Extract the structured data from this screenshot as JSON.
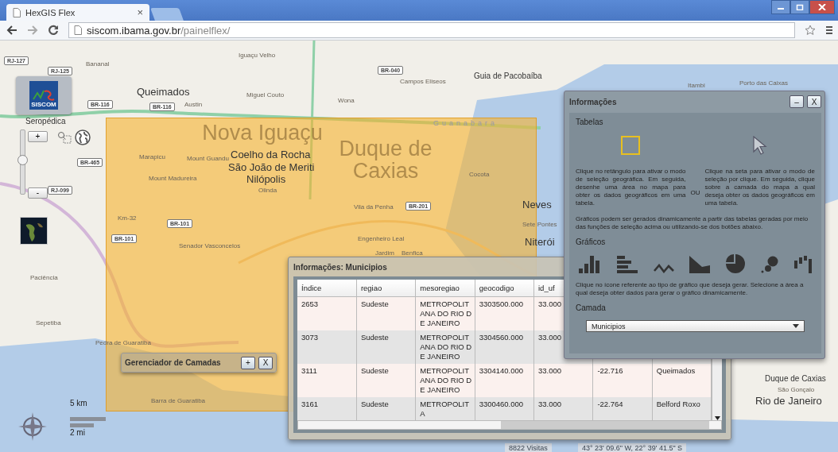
{
  "browser": {
    "tab_title": "HexGIS Flex",
    "tab_close": "×",
    "url_host": "siscom.ibama.gov.br",
    "url_path": "/painelflex/"
  },
  "map": {
    "logo_text": "SISCOM",
    "zoom_in": "+",
    "zoom_out": "-",
    "zoom_slider": {
      "level": 0.53
    },
    "labels": [
      {
        "text": "Queimados",
        "kind": "city"
      },
      {
        "text": "Nova Iguaçu",
        "kind": "big"
      },
      {
        "text": "Coelho da Rocha",
        "kind": "city"
      },
      {
        "text": "São João de Meriti",
        "kind": "city"
      },
      {
        "text": "Nilópolis",
        "kind": "city"
      },
      {
        "text": "Duque de Caxias",
        "kind": "big"
      },
      {
        "text": "Olinda",
        "kind": "small"
      },
      {
        "text": "Seropédica",
        "kind": "place"
      },
      {
        "text": "Bananal",
        "kind": "small"
      },
      {
        "text": "Iguaçu Velho",
        "kind": "small"
      },
      {
        "text": "Miguel Couto",
        "kind": "small"
      },
      {
        "text": "Austin",
        "kind": "small"
      },
      {
        "text": "Wona",
        "kind": "small"
      },
      {
        "text": "Campos Eliseos",
        "kind": "small"
      },
      {
        "text": "Guia de Pacobaíba",
        "kind": "place"
      },
      {
        "text": "Marapicu",
        "kind": "small"
      },
      {
        "text": "Mount Guandu",
        "kind": "small"
      },
      {
        "text": "Mount Madureira",
        "kind": "small"
      },
      {
        "text": "Km-32",
        "kind": "small"
      },
      {
        "text": "Vila da Penha",
        "kind": "small"
      },
      {
        "text": "Engenheiro Leal",
        "kind": "small"
      },
      {
        "text": "Jardim",
        "kind": "small"
      },
      {
        "text": "Senador Vasconcelos",
        "kind": "small"
      },
      {
        "text": "Paciência",
        "kind": "small"
      },
      {
        "text": "Sepetiba",
        "kind": "small"
      },
      {
        "text": "Pedra de Guaratiba",
        "kind": "small"
      },
      {
        "text": "Neves",
        "kind": "city"
      },
      {
        "text": "Sete Pontes",
        "kind": "small"
      },
      {
        "text": "Niterói",
        "kind": "city"
      },
      {
        "text": "São Gonçalo",
        "kind": "small"
      },
      {
        "text": "Rio de Janeiro",
        "kind": "city"
      },
      {
        "text": "Itambi",
        "kind": "small"
      },
      {
        "text": "Porto das Caixas",
        "kind": "small"
      },
      {
        "text": "Guanabara",
        "kind": "water"
      },
      {
        "text": "Cocota",
        "kind": "small"
      },
      {
        "text": "Benfica",
        "kind": "small"
      },
      {
        "text": "Duque de Caxias",
        "kind": "place"
      },
      {
        "text": "Barra de Guaratiba",
        "kind": "small"
      }
    ],
    "shields": [
      "RJ-127",
      "RJ-125",
      "BR-116",
      "BR-116",
      "BR-465",
      "RJ-099",
      "BR-101",
      "BR-101",
      "BR-040",
      "BR-201"
    ],
    "scale_km": "5 km",
    "scale_mi": "2 mi",
    "visits": "8822 Visitas",
    "coordinates": "43° 23' 09.6\" W, 22° 39' 41.5\" S"
  },
  "layer_manager": {
    "title": "Gerenciador de Camadas",
    "buttons": [
      "+",
      "X"
    ]
  },
  "table_panel": {
    "title": "Informações: Municipios",
    "columns": [
      "Índice",
      "regiao",
      "mesoregiao",
      "geocodigo",
      "id_uf"
    ],
    "rows": [
      [
        "2653",
        "Sudeste",
        "METROPOLITANA DO RIO DE JANEIRO",
        "3303500.000",
        "33.000"
      ],
      [
        "3073",
        "Sudeste",
        "METROPOLITANA DO RIO DE JANEIRO",
        "3304560.000",
        "33.000"
      ],
      [
        "3111",
        "Sudeste",
        "METROPOLITANA DO RIO DE JANEIRO",
        "3304140.000",
        "33.000",
        "-22.716",
        "Queimados"
      ],
      [
        "3161",
        "Sudeste",
        "METROPOLITA",
        "3300460.000",
        "33.000",
        "-22.764",
        "Belford Roxo"
      ]
    ]
  },
  "info_panel": {
    "title": "Informações",
    "buttons": [
      "–",
      "X"
    ],
    "tables_heading": "Tabelas",
    "left_text": "Clique no retângulo para ativar o modo de seleção geográfica. Em seguida, desenhe uma área no mapa para obter os dados geográficos em uma tabela.",
    "or_text": "OU",
    "right_text": "Clique na seta para ativar o modo de seleção por clique. Em seguida, clique sobre a camada do mapa a qual deseja obter os dados geográficos em uma tabela.",
    "charts_intro": "Gráficos podem ser gerados dinamicamente a partir das tabelas geradas por meio das funções de seleção acima ou utilizando-se dos botões abaixo.",
    "charts_heading": "Gráficos",
    "chart_buttons": [
      {
        "kind": "bar"
      },
      {
        "kind": "hbar"
      },
      {
        "kind": "line"
      },
      {
        "kind": "area"
      },
      {
        "kind": "pie"
      },
      {
        "kind": "bubble"
      },
      {
        "kind": "floating"
      }
    ],
    "charts_hint": "Clique no ícone referente ao tipo de gráfico que deseja gerar. Selecione a área a qual deseja obter dados para gerar o gráfico dinamicamente.",
    "layer_label": "Camada",
    "layer_value": "Municipios"
  }
}
